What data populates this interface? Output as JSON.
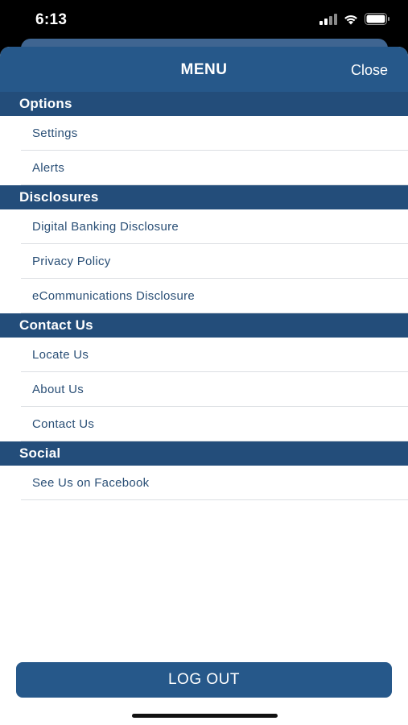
{
  "status_bar": {
    "time": "6:13",
    "icons": [
      "cellular-signal-icon",
      "wifi-icon",
      "battery-icon"
    ]
  },
  "nav": {
    "title": "MENU",
    "close_label": "Close"
  },
  "sections": [
    {
      "title": "Options",
      "items": [
        "Settings",
        "Alerts"
      ]
    },
    {
      "title": "Disclosures",
      "items": [
        "Digital Banking Disclosure",
        "Privacy Policy",
        "eCommunications Disclosure"
      ]
    },
    {
      "title": "Contact Us",
      "items": [
        "Locate Us",
        "About Us",
        "Contact Us"
      ]
    },
    {
      "title": "Social",
      "items": [
        "See Us on Facebook"
      ]
    }
  ],
  "logout_label": "LOG OUT",
  "colors": {
    "brand": "#26588a",
    "section_header": "#234d7a",
    "item_text": "#2a4f76"
  }
}
